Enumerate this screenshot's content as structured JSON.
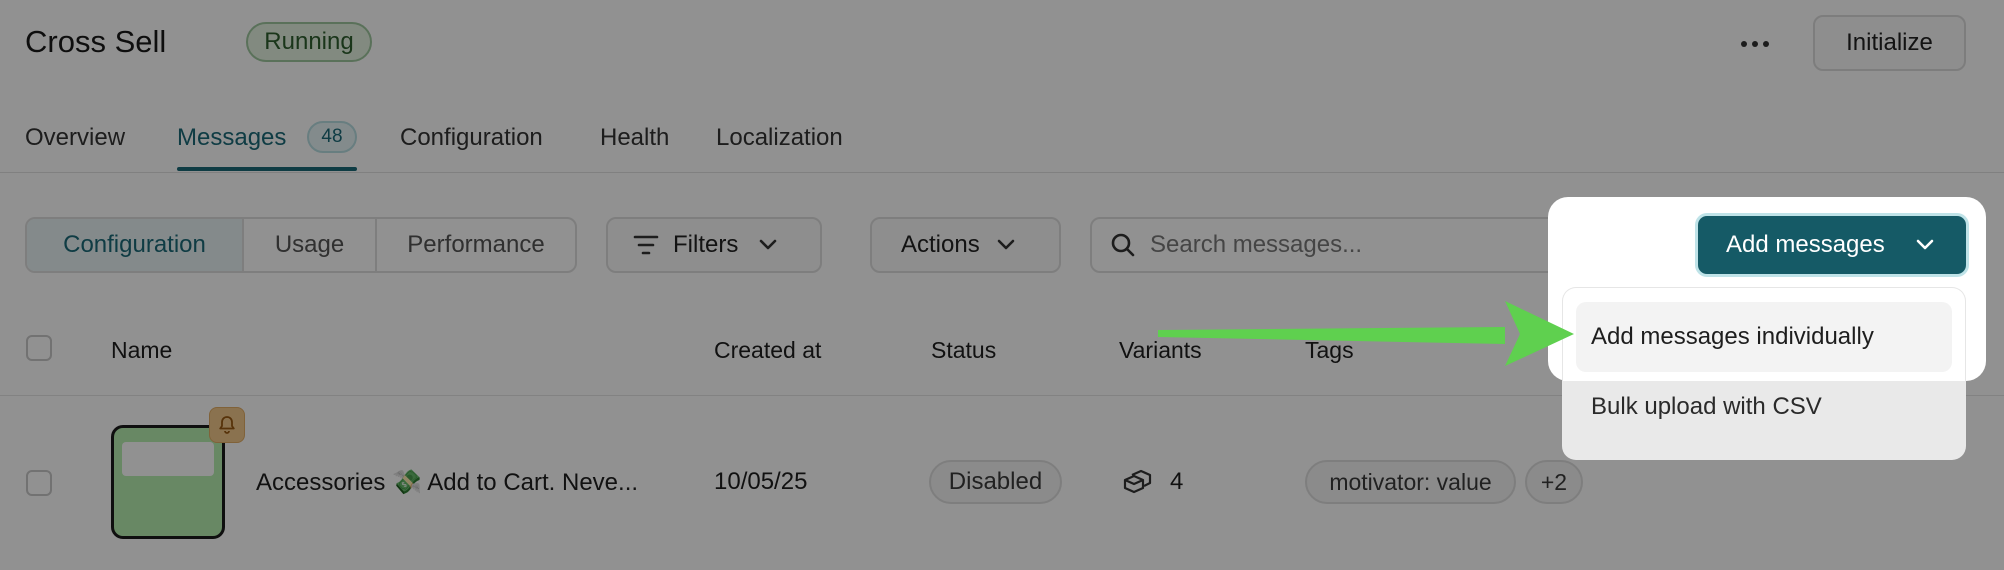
{
  "header": {
    "title": "Cross Sell",
    "status": "Running",
    "more_icon": "ellipsis-icon",
    "initialize_label": "Initialize"
  },
  "tabs": {
    "items": [
      {
        "label": "Overview"
      },
      {
        "label": "Messages",
        "count": "48",
        "active": true
      },
      {
        "label": "Configuration"
      },
      {
        "label": "Health"
      },
      {
        "label": "Localization"
      }
    ]
  },
  "toolbar": {
    "views": [
      {
        "label": "Configuration",
        "active": true
      },
      {
        "label": "Usage"
      },
      {
        "label": "Performance"
      }
    ],
    "filters_label": "Filters",
    "actions_label": "Actions",
    "search_placeholder": "Search messages...",
    "add_label": "Add messages"
  },
  "add_menu": {
    "items": [
      {
        "label": "Add messages individually",
        "highlighted": true
      },
      {
        "label": "Bulk upload with CSV"
      }
    ]
  },
  "table": {
    "columns": [
      "Name",
      "Created at",
      "Status",
      "Variants",
      "Tags"
    ],
    "rows": [
      {
        "name": "Accessories 💸 Add to Cart. Neve...",
        "created_at": "10/05/25",
        "status": "Disabled",
        "variants": "4",
        "tags": [
          "motivator: value",
          "+2"
        ]
      }
    ]
  },
  "colors": {
    "accent": "#155a66",
    "tab_active": "#1c6a78",
    "running_bg": "#e4f3e1",
    "arrow": "#5fd04f"
  }
}
